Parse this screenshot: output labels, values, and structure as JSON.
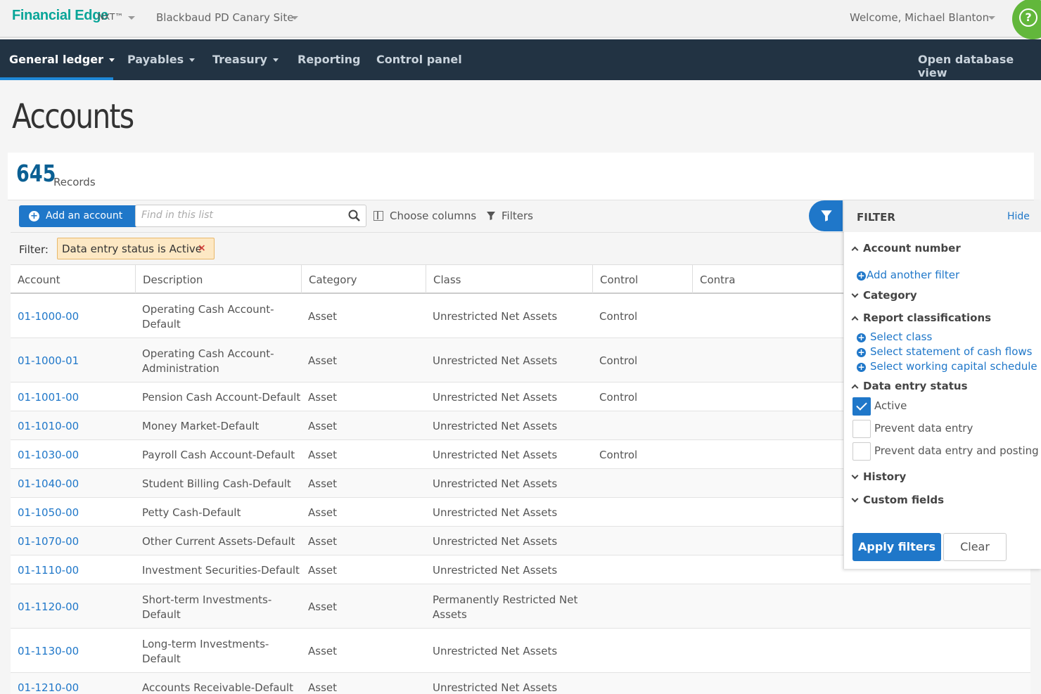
{
  "topbar": {
    "brand": "Financial Edge",
    "brand_sub": "NXT™",
    "site": "Blackbaud PD Canary Site",
    "welcome": "Welcome, Michael Blanton",
    "help_glyph": "?"
  },
  "nav": {
    "items": [
      {
        "label": "General ledger"
      },
      {
        "label": "Payables"
      },
      {
        "label": "Treasury"
      },
      {
        "label": "Reporting"
      },
      {
        "label": "Control panel"
      }
    ],
    "right": "Open database view"
  },
  "page": {
    "title": "Accounts",
    "records_count": "645",
    "records_label": "Records"
  },
  "toolbar": {
    "add_label": "Add an account",
    "search_placeholder": "Find in this list",
    "choose_columns": "Choose columns",
    "filters": "Filters"
  },
  "filter_summary": {
    "label": "Filter:",
    "chip": "Data entry status is Active",
    "chip_remove": "×"
  },
  "table": {
    "columns": [
      "Account",
      "Description",
      "Category",
      "Class",
      "Control",
      "Contra"
    ],
    "rows": [
      {
        "account": "01-1000-00",
        "desc": [
          "Operating Cash Account-",
          "Default"
        ],
        "category": "Asset",
        "class": [
          "Unrestricted Net Assets"
        ],
        "control": "Control",
        "contra": ""
      },
      {
        "account": "01-1000-01",
        "desc": [
          "Operating Cash Account-",
          "Administration"
        ],
        "category": "Asset",
        "class": [
          "Unrestricted Net Assets"
        ],
        "control": "Control",
        "contra": ""
      },
      {
        "account": "01-1001-00",
        "desc": [
          "Pension Cash Account-Default"
        ],
        "category": "Asset",
        "class": [
          "Unrestricted Net Assets"
        ],
        "control": "Control",
        "contra": ""
      },
      {
        "account": "01-1010-00",
        "desc": [
          "Money Market-Default"
        ],
        "category": "Asset",
        "class": [
          "Unrestricted Net Assets"
        ],
        "control": "",
        "contra": ""
      },
      {
        "account": "01-1030-00",
        "desc": [
          "Payroll Cash Account-Default"
        ],
        "category": "Asset",
        "class": [
          "Unrestricted Net Assets"
        ],
        "control": "Control",
        "contra": ""
      },
      {
        "account": "01-1040-00",
        "desc": [
          "Student Billing Cash-Default"
        ],
        "category": "Asset",
        "class": [
          "Unrestricted Net Assets"
        ],
        "control": "",
        "contra": ""
      },
      {
        "account": "01-1050-00",
        "desc": [
          "Petty Cash-Default"
        ],
        "category": "Asset",
        "class": [
          "Unrestricted Net Assets"
        ],
        "control": "",
        "contra": ""
      },
      {
        "account": "01-1070-00",
        "desc": [
          "Other Current Assets-Default"
        ],
        "category": "Asset",
        "class": [
          "Unrestricted Net Assets"
        ],
        "control": "",
        "contra": ""
      },
      {
        "account": "01-1110-00",
        "desc": [
          "Investment Securities-Default"
        ],
        "category": "Asset",
        "class": [
          "Unrestricted Net Assets"
        ],
        "control": "",
        "contra": ""
      },
      {
        "account": "01-1120-00",
        "desc": [
          "Short-term Investments-",
          "Default"
        ],
        "category": "Asset",
        "class": [
          "Permanently Restricted Net",
          "Assets"
        ],
        "control": "",
        "contra": ""
      },
      {
        "account": "01-1130-00",
        "desc": [
          "Long-term Investments-",
          "Default"
        ],
        "category": "Asset",
        "class": [
          "Unrestricted Net Assets"
        ],
        "control": "",
        "contra": ""
      },
      {
        "account": "01-1210-00",
        "desc": [
          "Accounts Receivable-Default"
        ],
        "category": "Asset",
        "class": [
          "Unrestricted Net Assets"
        ],
        "control": "",
        "contra": ""
      }
    ]
  },
  "filter_panel": {
    "title": "FILTER",
    "hide": "Hide",
    "account_number": "Account number",
    "add_another": "Add another filter",
    "category": "Category",
    "report_classifications": "Report classifications",
    "select_class": "Select class",
    "select_cash_flows": "Select statement of cash flows",
    "select_working_capital": "Select working capital schedule",
    "data_entry_status": "Data entry status",
    "options": [
      {
        "label": "Active",
        "checked": true
      },
      {
        "label": "Prevent data entry",
        "checked": false
      },
      {
        "label": "Prevent data entry and posting",
        "checked": false
      }
    ],
    "history": "History",
    "custom_fields": "Custom fields",
    "apply": "Apply filters",
    "clear": "Clear"
  },
  "colors": {
    "brand": "#08a598",
    "nav_bg": "#223343",
    "accent": "#1f77c9",
    "help": "#62b73b",
    "chip_bg": "#fde8c4"
  }
}
